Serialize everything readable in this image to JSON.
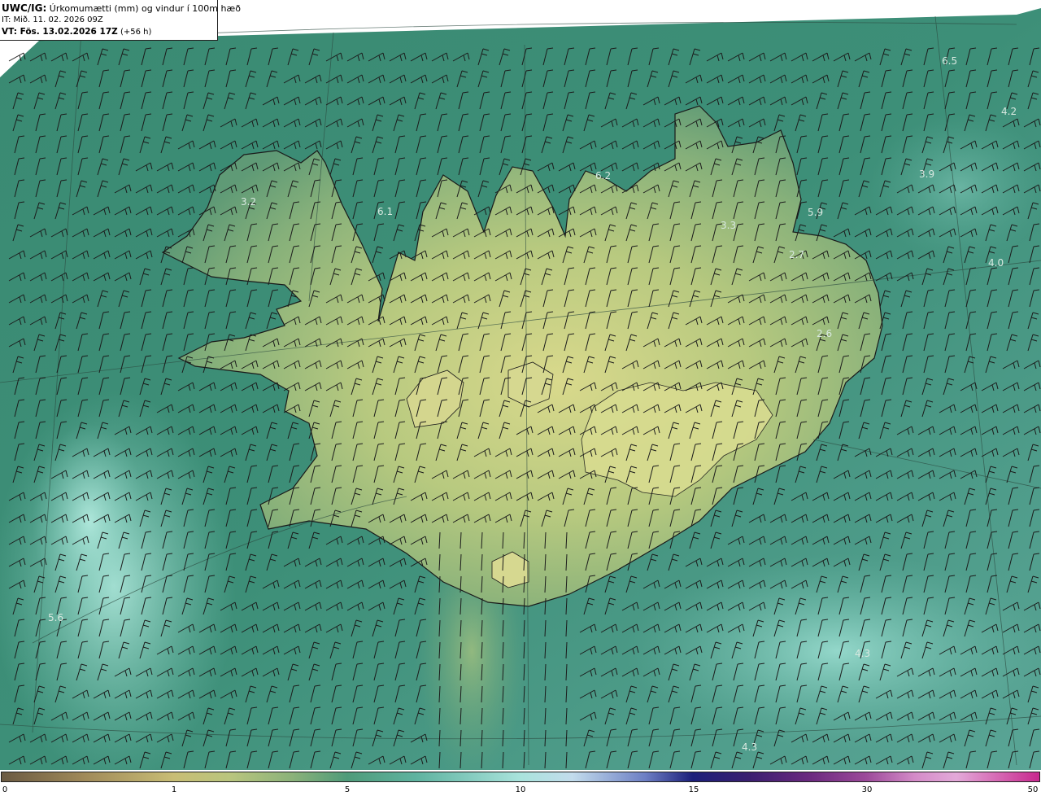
{
  "header": {
    "model": "UWC/IG:",
    "field": "Úrkomumætti (mm) og vindur í 100m hæð",
    "init_time": "IT: Mið. 11. 02. 2026 09Z",
    "valid_prefix": "VT:",
    "valid_time": "Fös. 13.02.2026 17Z",
    "lead": "(+56 h)"
  },
  "colorbar": {
    "ticks": [
      {
        "label": "0",
        "value": 0
      },
      {
        "label": "1",
        "value": 1
      },
      {
        "label": "5",
        "value": 5
      },
      {
        "label": "10",
        "value": 10
      },
      {
        "label": "15",
        "value": 15
      },
      {
        "label": "30",
        "value": 30
      },
      {
        "label": "50",
        "value": 50
      }
    ]
  },
  "map_labels": [
    {
      "text": "3.2",
      "id": "westfjords"
    },
    {
      "text": "6.1",
      "id": "hunafloi"
    },
    {
      "text": "6.2",
      "id": "skjalfandi"
    },
    {
      "text": "3.3",
      "id": "north-east-inland"
    },
    {
      "text": "5.9",
      "id": "vopnafjordur"
    },
    {
      "text": "2.7",
      "id": "east-coast-north"
    },
    {
      "text": "2.6",
      "id": "east-coast"
    },
    {
      "text": "6.5",
      "id": "ne-ocean-top"
    },
    {
      "text": "4.2",
      "id": "ne-ocean-right"
    },
    {
      "text": "3.9",
      "id": "ne-ocean"
    },
    {
      "text": "4.0",
      "id": "east-ocean"
    },
    {
      "text": "5.6",
      "id": "sw-ocean"
    },
    {
      "text": "4.3",
      "id": "se-ocean"
    },
    {
      "text": "4.3",
      "id": "s-ocean-bottom"
    }
  ],
  "colors": {
    "ocean": "#3f8e78",
    "land_high": "#d6d88a",
    "colorbar_dry": "#7a5a3a",
    "colorbar_wet": "#c8288e"
  }
}
